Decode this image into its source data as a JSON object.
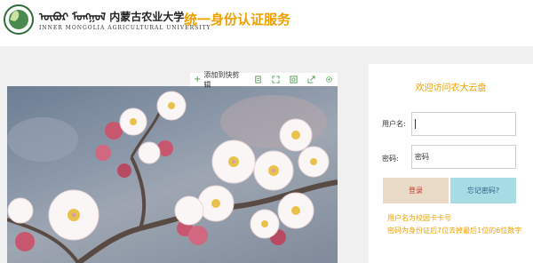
{
  "header": {
    "university_script": "ᠦᠪᠦᠷ ᠮᠣᠩᠭᠣᠯ 内蒙古农业大学",
    "university_en": "INNER MONGOLIA AGRICULTURAL UNIVERSITY",
    "system_title": "统一身份认证服务"
  },
  "toolbar": {
    "add_label": "添加到快剪辑",
    "icons": [
      "page-icon",
      "expand-icon",
      "screenshot-icon",
      "share-icon",
      "settings-icon"
    ]
  },
  "login": {
    "welcome": "欢迎访问农大云盘",
    "username_label": "用户名:",
    "username_value": "",
    "password_label": "密码:",
    "password_value": "密码",
    "login_button": "登录",
    "forgot_button": "忘记密码?",
    "hint_1": "用户名为校园卡卡号",
    "hint_2": "密码为身份证后7位去掉最后1位的6位数字"
  },
  "colors": {
    "accent": "#f0a000",
    "login_button_bg": "#eadbc8",
    "forgot_button_bg": "#a8dce4",
    "logo_green": "#2f6d3a"
  }
}
